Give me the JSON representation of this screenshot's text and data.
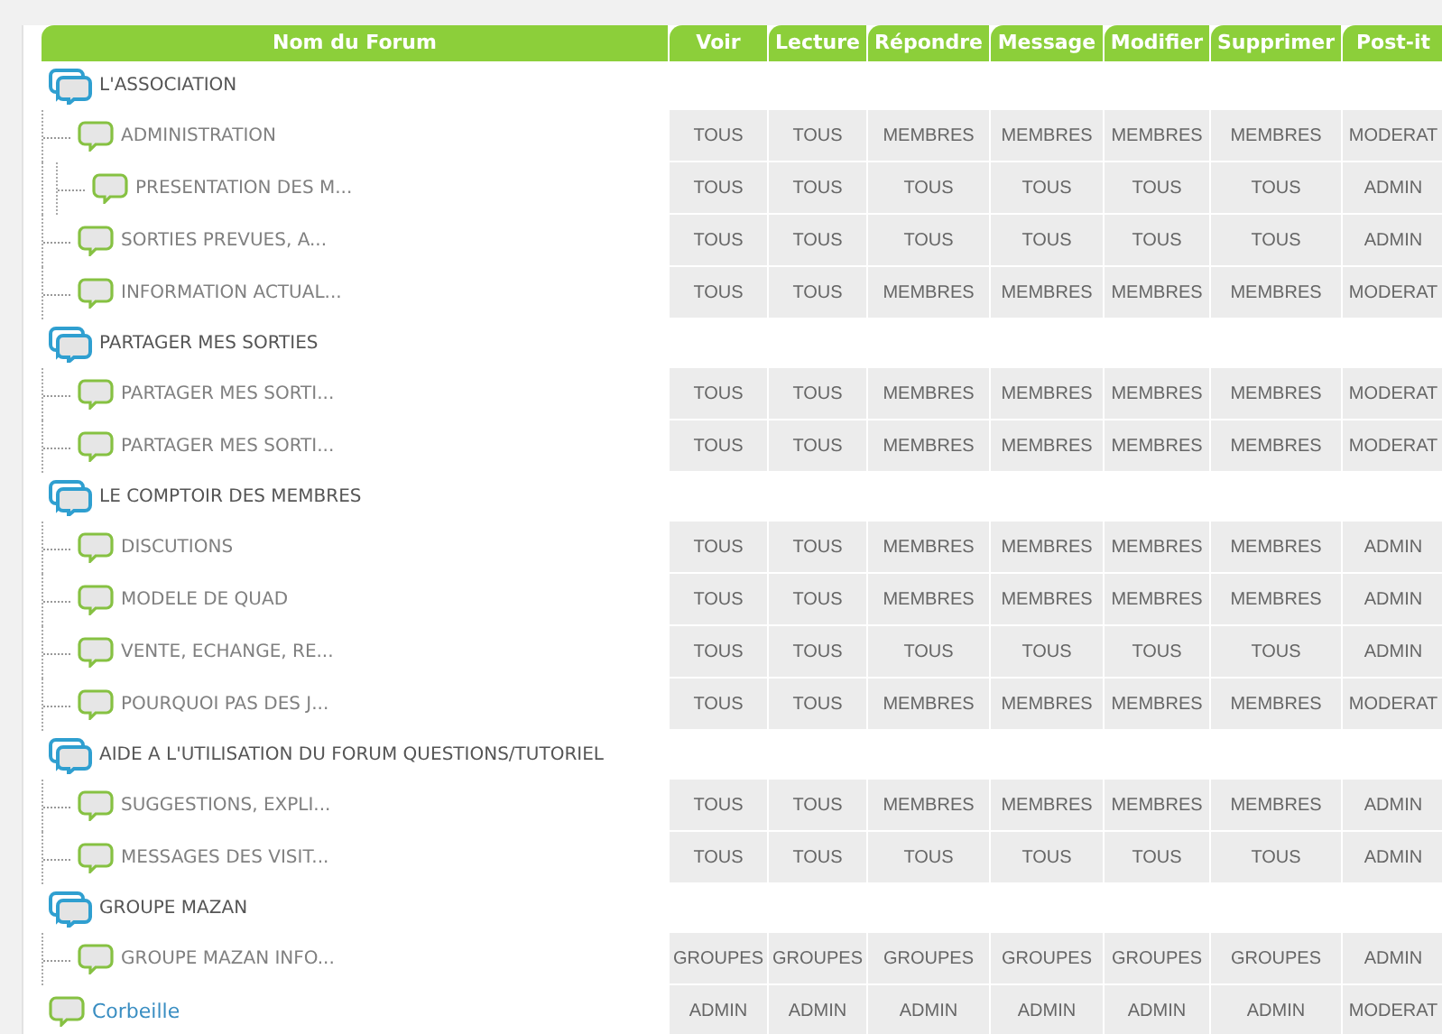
{
  "table": {
    "columns": [
      "Nom du Forum",
      "Voir",
      "Lecture",
      "Répondre",
      "Message",
      "Modifier",
      "Supprimer",
      "Post-it"
    ],
    "rows": [
      {
        "kind": "category",
        "name": "L'ASSOCIATION",
        "children": [
          {
            "kind": "forum",
            "name": "ADMINISTRATION",
            "permissions": [
              "TOUS",
              "TOUS",
              "MEMBRES",
              "MEMBRES",
              "MEMBRES",
              "MEMBRES",
              "MODERAT"
            ],
            "children": [
              {
                "kind": "forum",
                "name": "PRESENTATION DES M...",
                "permissions": [
                  "TOUS",
                  "TOUS",
                  "TOUS",
                  "TOUS",
                  "TOUS",
                  "TOUS",
                  "ADMIN"
                ]
              }
            ]
          },
          {
            "kind": "forum",
            "name": "SORTIES PREVUES, A...",
            "permissions": [
              "TOUS",
              "TOUS",
              "TOUS",
              "TOUS",
              "TOUS",
              "TOUS",
              "ADMIN"
            ]
          },
          {
            "kind": "forum",
            "name": "INFORMATION ACTUAL...",
            "permissions": [
              "TOUS",
              "TOUS",
              "MEMBRES",
              "MEMBRES",
              "MEMBRES",
              "MEMBRES",
              "MODERAT"
            ]
          }
        ]
      },
      {
        "kind": "category",
        "name": "PARTAGER MES SORTIES",
        "children": [
          {
            "kind": "forum",
            "name": "PARTAGER MES SORTI...",
            "permissions": [
              "TOUS",
              "TOUS",
              "MEMBRES",
              "MEMBRES",
              "MEMBRES",
              "MEMBRES",
              "MODERAT"
            ]
          },
          {
            "kind": "forum",
            "name": "PARTAGER MES SORTI...",
            "permissions": [
              "TOUS",
              "TOUS",
              "MEMBRES",
              "MEMBRES",
              "MEMBRES",
              "MEMBRES",
              "MODERAT"
            ]
          }
        ]
      },
      {
        "kind": "category",
        "name": "LE COMPTOIR DES MEMBRES",
        "children": [
          {
            "kind": "forum",
            "name": "DISCUTIONS",
            "permissions": [
              "TOUS",
              "TOUS",
              "MEMBRES",
              "MEMBRES",
              "MEMBRES",
              "MEMBRES",
              "ADMIN"
            ]
          },
          {
            "kind": "forum",
            "name": "MODELE DE QUAD",
            "permissions": [
              "TOUS",
              "TOUS",
              "MEMBRES",
              "MEMBRES",
              "MEMBRES",
              "MEMBRES",
              "ADMIN"
            ]
          },
          {
            "kind": "forum",
            "name": "VENTE, ECHANGE, RE...",
            "permissions": [
              "TOUS",
              "TOUS",
              "TOUS",
              "TOUS",
              "TOUS",
              "TOUS",
              "ADMIN"
            ]
          },
          {
            "kind": "forum",
            "name": "POURQUOI PAS DES J...",
            "permissions": [
              "TOUS",
              "TOUS",
              "MEMBRES",
              "MEMBRES",
              "MEMBRES",
              "MEMBRES",
              "MODERAT"
            ]
          }
        ]
      },
      {
        "kind": "category",
        "name": "AIDE A L'UTILISATION DU FORUM QUESTIONS/TUTORIEL",
        "children": [
          {
            "kind": "forum",
            "name": "SUGGESTIONS, EXPLI...",
            "permissions": [
              "TOUS",
              "TOUS",
              "MEMBRES",
              "MEMBRES",
              "MEMBRES",
              "MEMBRES",
              "ADMIN"
            ]
          },
          {
            "kind": "forum",
            "name": "MESSAGES DES VISIT...",
            "permissions": [
              "TOUS",
              "TOUS",
              "TOUS",
              "TOUS",
              "TOUS",
              "TOUS",
              "ADMIN"
            ]
          }
        ]
      },
      {
        "kind": "category",
        "name": "GROUPE MAZAN",
        "children": [
          {
            "kind": "forum",
            "name": "GROUPE MAZAN INFO...",
            "permissions": [
              "GROUPES",
              "GROUPES",
              "GROUPES",
              "GROUPES",
              "GROUPES",
              "GROUPES",
              "ADMIN"
            ]
          }
        ]
      },
      {
        "kind": "trash",
        "name": "Corbeille",
        "permissions": [
          "ADMIN",
          "ADMIN",
          "ADMIN",
          "ADMIN",
          "ADMIN",
          "ADMIN",
          "MODERAT"
        ]
      }
    ]
  }
}
